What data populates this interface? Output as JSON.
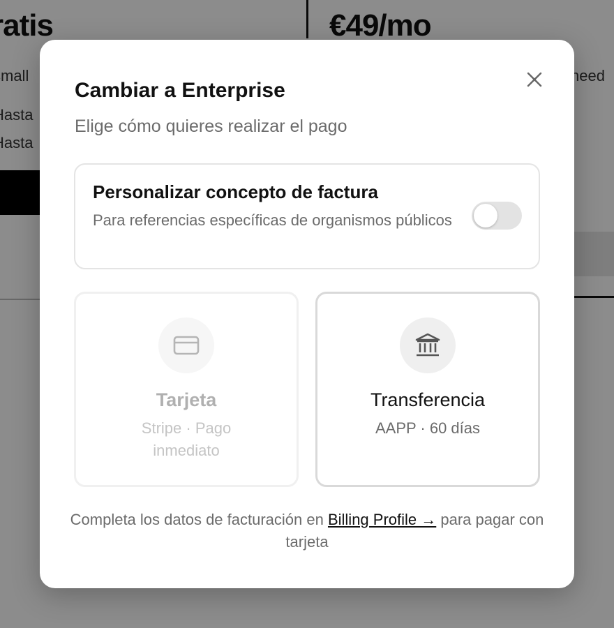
{
  "background": {
    "plan_left_price": "ratis",
    "plan_right_price": "€49/mo",
    "left_desc_fragment": "small",
    "right_desc_fragment": "need",
    "left_feature_1": "Hasta",
    "left_feature_2": "Hasta"
  },
  "modal": {
    "title": "Cambiar a Enterprise",
    "subtitle": "Elige cómo quieres realizar el pago",
    "close_icon": "close-icon",
    "custom_invoice": {
      "title": "Personalizar concepto de factura",
      "description": "Para referencias específicas de organismos públicos",
      "enabled": false
    },
    "options": [
      {
        "id": "card",
        "icon": "credit-card-icon",
        "label": "Tarjeta",
        "sub": "Stripe · Pago inmediato",
        "disabled": true
      },
      {
        "id": "transfer",
        "icon": "bank-icon",
        "label": "Transferencia",
        "sub": "AAPP · 60 días",
        "disabled": false
      }
    ],
    "footer": {
      "text_before": "Completa los datos de facturación en ",
      "link": "Billing Profile →",
      "text_after": " para pagar con tarjeta"
    }
  },
  "colors": {
    "muted_text": "#6b6b6b",
    "disabled_text": "#b0b0b0",
    "switch_off": "#e3e3e3"
  }
}
